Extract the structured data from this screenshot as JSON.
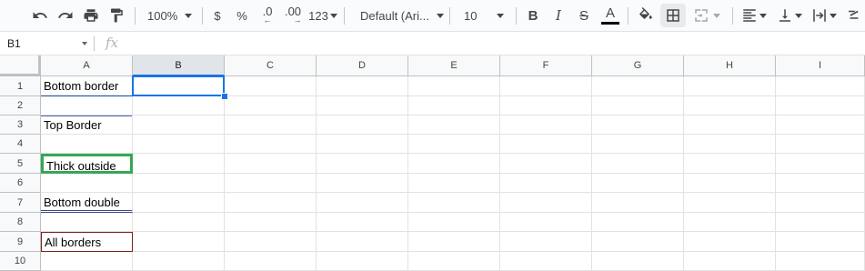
{
  "toolbar": {
    "zoom": "100%",
    "currency": "$",
    "percent": "%",
    "decimal_decrease": ".0",
    "decimal_increase": ".00",
    "number_format": "123",
    "font": "Default (Ari...",
    "font_size": "10",
    "text_color": "#000000"
  },
  "namebox": {
    "value": "B1"
  },
  "formula": {
    "icon_text": "fx",
    "value": ""
  },
  "columns": [
    "A",
    "B",
    "C",
    "D",
    "E",
    "F",
    "G",
    "H",
    "I"
  ],
  "rows": [
    "1",
    "2",
    "3",
    "4",
    "5",
    "6",
    "7",
    "8",
    "9",
    "10"
  ],
  "cells": {
    "A1": "Bottom border",
    "A3": "Top Border",
    "A5": "Thick outside",
    "A7": "Bottom double",
    "A9": "All borders"
  },
  "selected_cell": "B1",
  "colors": {
    "selection": "#1a73e8",
    "thick_outside_border": "#34a853",
    "all_borders": "#7f1f1f",
    "bottom_border": "#1c4587"
  }
}
